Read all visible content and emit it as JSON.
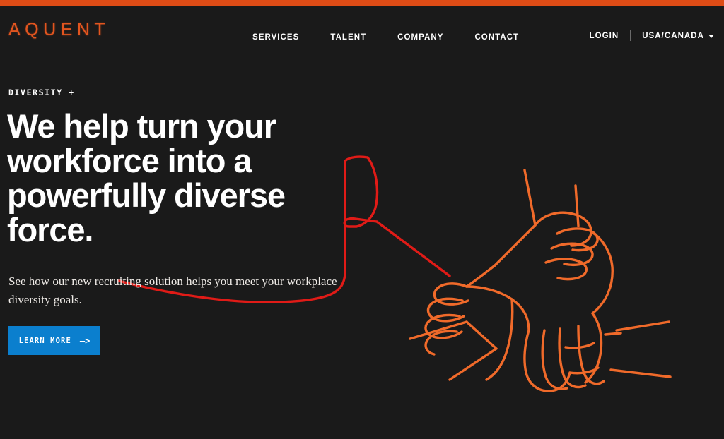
{
  "colors": {
    "accent_bar": "#de4c16",
    "background": "#1a1a1a",
    "brand_orange": "#e2551f",
    "cta_blue": "#0b7fce",
    "illustration_red": "#e01b17",
    "illustration_orange": "#f06a2a",
    "text_white": "#ffffff"
  },
  "header": {
    "brand": "AQUENT",
    "nav": [
      {
        "label": "SERVICES",
        "name": "nav-link-services"
      },
      {
        "label": "TALENT",
        "name": "nav-link-talent"
      },
      {
        "label": "COMPANY",
        "name": "nav-link-company"
      },
      {
        "label": "CONTACT",
        "name": "nav-link-contact"
      }
    ],
    "login_label": "LOGIN",
    "locale_label": "USA/CANADA",
    "locale_caret_icon": "chevron-down-icon"
  },
  "hero": {
    "eyebrow": "DIVERSITY +",
    "title": "We help turn your workforce into a powerfully diverse force.",
    "subtitle": "See how our new recruiting solution helps you meet your workplace diversity goals.",
    "cta": {
      "label": "LEARN MORE",
      "arrow_icon": "arrow-right-icon",
      "arrow_glyph": "–>"
    },
    "illustration_alt": "line-art of interlocking hands and a thumbs-up arm"
  }
}
